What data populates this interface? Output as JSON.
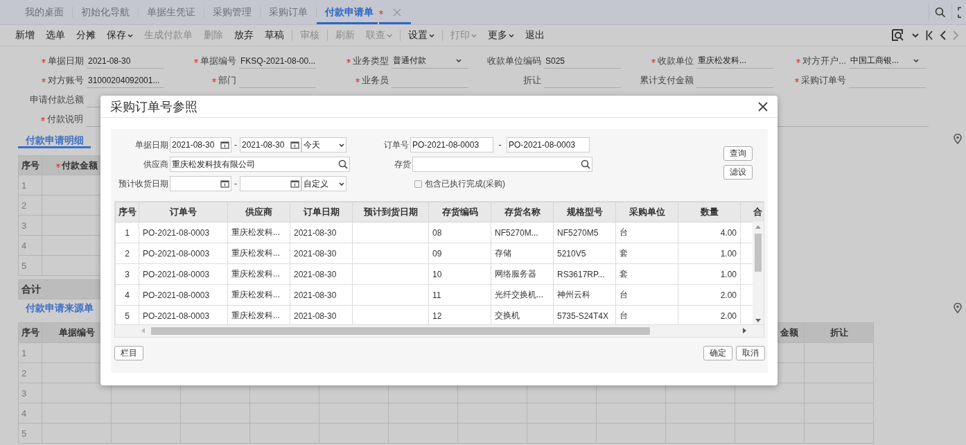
{
  "tabs": [
    {
      "label": "我的桌面",
      "selected": false,
      "modified": false
    },
    {
      "label": "初始化导航",
      "selected": false,
      "modified": false
    },
    {
      "label": "单据生凭证",
      "selected": false,
      "modified": false
    },
    {
      "label": "采购管理",
      "selected": false,
      "modified": false
    },
    {
      "label": "采购订单",
      "selected": false,
      "modified": false
    },
    {
      "label": "付款申请单",
      "selected": true,
      "modified": true
    }
  ],
  "toolbar": [
    {
      "kind": "button",
      "label": "新增",
      "disabled": false
    },
    {
      "kind": "button",
      "label": "选单",
      "disabled": false
    },
    {
      "kind": "button",
      "label": "分摊",
      "disabled": false
    },
    {
      "kind": "menu",
      "label": "保存",
      "disabled": false
    },
    {
      "kind": "button",
      "label": "生成付款单",
      "disabled": true
    },
    {
      "kind": "button",
      "label": "删除",
      "disabled": true
    },
    {
      "kind": "button",
      "label": "放弃",
      "disabled": false
    },
    {
      "kind": "button",
      "label": "草稿",
      "disabled": false
    },
    {
      "kind": "separator"
    },
    {
      "kind": "button",
      "label": "审核",
      "disabled": true
    },
    {
      "kind": "separator"
    },
    {
      "kind": "button",
      "label": "刷新",
      "disabled": true
    },
    {
      "kind": "menu",
      "label": "联查",
      "disabled": true
    },
    {
      "kind": "separator"
    },
    {
      "kind": "menu",
      "label": "设置",
      "disabled": false
    },
    {
      "kind": "separator"
    },
    {
      "kind": "menu",
      "label": "打印",
      "disabled": true
    },
    {
      "kind": "menu",
      "label": "更多",
      "disabled": false
    },
    {
      "kind": "button",
      "label": "退出",
      "disabled": false
    }
  ],
  "form": [
    {
      "kind": "text",
      "label": "单据日期",
      "value": "2021-08-30",
      "required": true
    },
    {
      "kind": "text",
      "label": "单据编号",
      "value": "FKSQ-2021-08-00...",
      "required": true
    },
    {
      "kind": "select",
      "label": "业务类型",
      "value": "普通付款",
      "required": true
    },
    {
      "kind": "text",
      "label": "收款单位编码",
      "value": "S025",
      "required": false
    },
    {
      "kind": "text",
      "label": "收款单位",
      "value": "重庆松发科...",
      "required": true
    },
    {
      "kind": "select",
      "label": "对方开户...",
      "value": "中国工商银...",
      "required": true
    },
    {
      "kind": "text",
      "label": "对方账号",
      "value": "31000204092001...",
      "required": true
    },
    {
      "kind": "text",
      "label": "部门",
      "required": true
    },
    {
      "kind": "text",
      "label": "业务员",
      "required": true
    },
    {
      "kind": "text",
      "label": "折让",
      "required": false
    },
    {
      "kind": "text",
      "label": "累计支付金额",
      "required": false
    },
    {
      "kind": "text",
      "label": "采购订单号",
      "required": true
    },
    {
      "kind": "row",
      "label": "申请付款总额",
      "required": false
    },
    {
      "kind": "memo",
      "label": "付款说明",
      "required": true
    }
  ],
  "detail_tab": {
    "label": "付款申请明细",
    "selected": true
  },
  "detail_table": {
    "columns": [
      {
        "label": "序号",
        "required": false
      },
      {
        "label": "付款金额",
        "required": true
      }
    ],
    "rows": [
      "1",
      "2",
      "3",
      "4",
      "5"
    ],
    "total_label": "合计"
  },
  "source_tab": {
    "label": "付款申请来源单",
    "selected": false
  },
  "source_table": {
    "columns": [
      {
        "label": "序号"
      },
      {
        "label": "单据编号"
      },
      {
        "label": "金额"
      },
      {
        "label": "折让"
      }
    ],
    "rows": [
      "1",
      "2",
      "3",
      "4",
      "5"
    ]
  },
  "dialog": {
    "title": "采购订单号参照",
    "filters": {
      "doc_date": {
        "label": "单据日期",
        "from": "2021-08-30",
        "to": "2021-08-30",
        "separator": "-",
        "range": "今天"
      },
      "order_no": {
        "label": "订单号",
        "from": "PO-2021-08-0003",
        "to": "PO-2021-08-0003",
        "separator": "-"
      },
      "supplier": {
        "label": "供应商",
        "value": "重庆松发科技有限公司"
      },
      "stock": {
        "label": "存货"
      },
      "expected_date": {
        "label": "预计收货日期",
        "separator": "-",
        "range": "自定义"
      },
      "include_done": {
        "label": "包含已执行完成(采购)",
        "checked": false
      }
    },
    "side_buttons": [
      "查询",
      "滤设"
    ],
    "grid": {
      "columns": [
        "序号",
        "订单号",
        "供应商",
        "订单日期",
        "预计到货日期",
        "存货编码",
        "存货名称",
        "规格型号",
        "采购单位",
        "数量",
        "合"
      ],
      "rows": [
        [
          "1",
          "PO-2021-08-0003",
          "重庆松发科...",
          "2021-08-30",
          null,
          "08",
          "NF5270M...",
          "NF5270M5",
          "台",
          "4.00"
        ],
        [
          "2",
          "PO-2021-08-0003",
          "重庆松发科...",
          "2021-08-30",
          null,
          "09",
          "存储",
          "5210V5",
          "套",
          "1.00"
        ],
        [
          "3",
          "PO-2021-08-0003",
          "重庆松发科...",
          "2021-08-30",
          null,
          "10",
          "网络服务器",
          "RS3617RP...",
          "套",
          "1.00"
        ],
        [
          "4",
          "PO-2021-08-0003",
          "重庆松发科...",
          "2021-08-30",
          null,
          "11",
          "光纤交换机...",
          "神州云科",
          "台",
          "2.00"
        ],
        [
          "5",
          "PO-2021-08-0003",
          "重庆松发科...",
          "2021-08-30",
          null,
          "12",
          "交换机",
          "5735-S24T4X",
          "台",
          "2.00"
        ]
      ]
    },
    "footer_left": "栏目",
    "footer_buttons": [
      "确定",
      "取消"
    ]
  }
}
